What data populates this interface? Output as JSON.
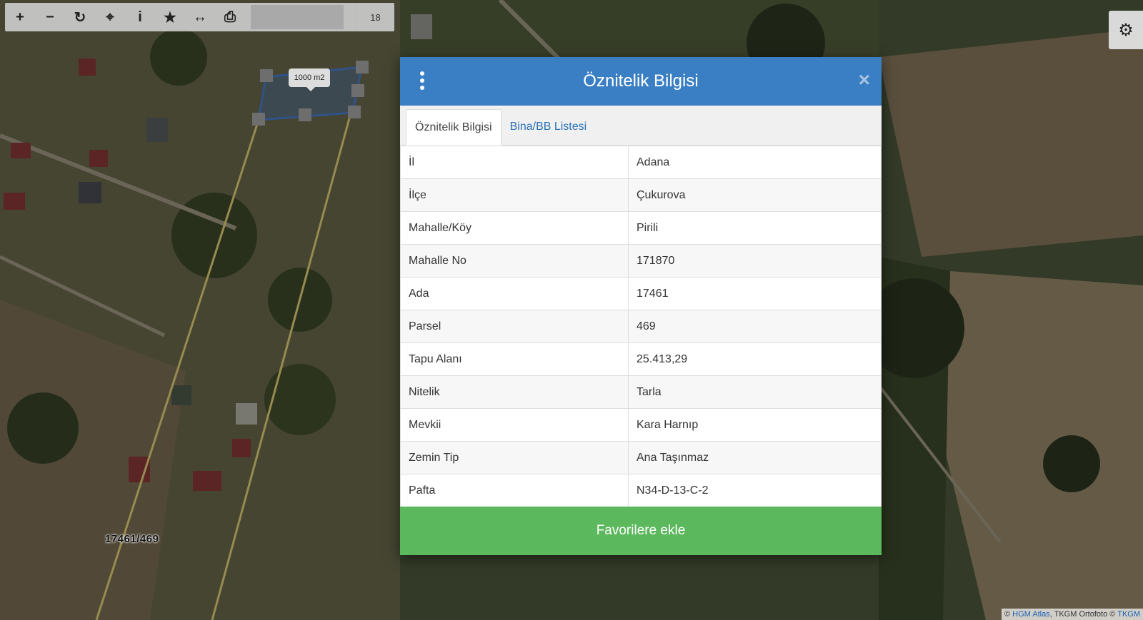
{
  "toolbar": {
    "buttons": [
      {
        "name": "zoom-in-icon",
        "glyph": "+"
      },
      {
        "name": "zoom-out-icon",
        "glyph": "−"
      },
      {
        "name": "refresh-icon",
        "glyph": "↻"
      },
      {
        "name": "locate-icon",
        "glyph": "⌖"
      },
      {
        "name": "info-icon",
        "glyph": "i"
      },
      {
        "name": "star-icon",
        "glyph": "★"
      },
      {
        "name": "measure-icon",
        "glyph": "↔"
      },
      {
        "name": "print-icon",
        "glyph": "⎙"
      }
    ],
    "zoom_level": "18"
  },
  "settings": {
    "icon": "gear-icon",
    "glyph": "⚙"
  },
  "map": {
    "parcel_label": "17461/469",
    "area_tag": "1000 m2",
    "attribution": {
      "prefix": "© ",
      "link1": "HGM Atlas",
      "middle": ", TKGM Ortofoto © ",
      "link2": "TKGM"
    },
    "colors": {
      "parcel_line": "#e8d67a",
      "selection": "#4a7fd0"
    }
  },
  "modal": {
    "title": "Öznitelik Bilgisi",
    "close_glyph": "×",
    "tabs": [
      "Öznitelik Bilgisi",
      "Bina/BB Listesi"
    ],
    "rows": [
      {
        "key": "İl",
        "value": "Adana"
      },
      {
        "key": "İlçe",
        "value": "Çukurova"
      },
      {
        "key": "Mahalle/Köy",
        "value": "Pirili"
      },
      {
        "key": "Mahalle No",
        "value": "171870"
      },
      {
        "key": "Ada",
        "value": "17461"
      },
      {
        "key": "Parsel",
        "value": "469"
      },
      {
        "key": "Tapu Alanı",
        "value": "25.413,29"
      },
      {
        "key": "Nitelik",
        "value": "Tarla"
      },
      {
        "key": "Mevkii",
        "value": "Kara Harnıp"
      },
      {
        "key": "Zemin Tip",
        "value": "Ana Taşınmaz"
      },
      {
        "key": "Pafta",
        "value": "N34-D-13-C-2"
      }
    ],
    "favorite_button": "Favorilere ekle",
    "colors": {
      "header": "#3a7fc4",
      "button": "#5cb85c",
      "tab_link": "#2a72b8"
    }
  }
}
